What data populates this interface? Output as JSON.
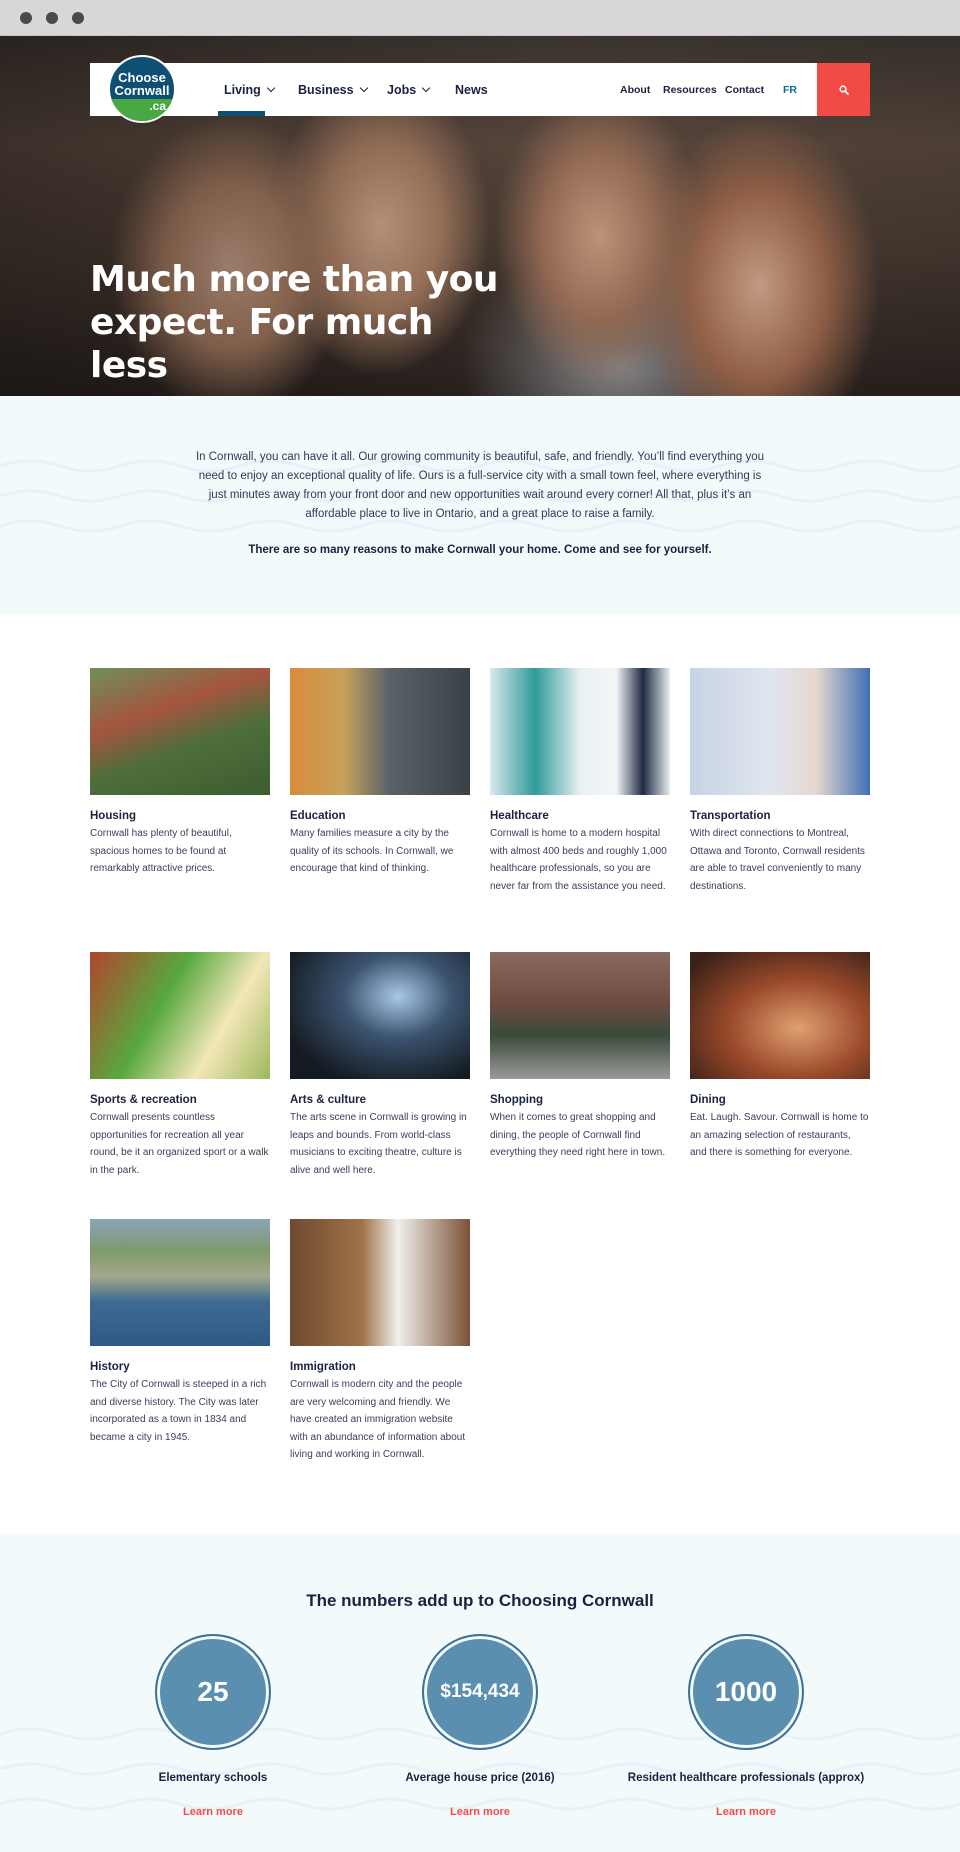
{
  "header": {
    "logo_text": "Choose Cornwall",
    "logo_suffix": ".ca",
    "nav": [
      {
        "label": "Living"
      },
      {
        "label": "Business"
      },
      {
        "label": "Jobs"
      },
      {
        "label": "News"
      }
    ],
    "secondary": [
      {
        "label": "About"
      },
      {
        "label": "Resources"
      },
      {
        "label": "Contact"
      },
      {
        "label": "FR"
      }
    ],
    "search_icon": "search-icon",
    "accent": "#f24a45",
    "brand": "#0f4f73"
  },
  "hero": {
    "title": "Much more than you expect. For much less"
  },
  "intro": {
    "paragraph": "In Cornwall, you can have it all. Our growing community is beautiful, safe, and friendly. You’ll find everything you need to enjoy an exceptional quality of life. Ours is a full-service city with a small town feel, where everything is just minutes away from your front door and new opportunities wait around every corner! All that, plus it’s an affordable place to live in Ontario, and a great place to raise a family.",
    "strong": "There are so many reasons to make Cornwall your home. Come and see for yourself."
  },
  "cards": [
    {
      "title": "Housing",
      "text": "Cornwall has plenty of beautiful, spacious homes to be found at remarkably attractive prices."
    },
    {
      "title": "Education",
      "text": "Many families measure a city by the quality of its schools. In Cornwall, we encourage that kind of thinking."
    },
    {
      "title": "Healthcare",
      "text": "Cornwall is home to a modern hospital with almost 400 beds and roughly 1,000 healthcare professionals, so you are never far from the assistance you need."
    },
    {
      "title": "Transportation",
      "text": "With direct connections to Montreal, Ottawa and Toronto, Cornwall residents are able to travel conveniently to many destinations."
    },
    {
      "title": "Sports & recreation",
      "text": "Cornwall presents countless opportunities for recreation all year round, be it an organized sport or a walk in the park."
    },
    {
      "title": "Arts & culture",
      "text": "The arts scene in Cornwall is growing in leaps and bounds. From world-class musicians to exciting theatre, culture is alive and well here."
    },
    {
      "title": "Shopping",
      "text": "When it comes to great shopping and dining, the people of Cornwall find everything they need right here in town."
    },
    {
      "title": "Dining",
      "text": "Eat. Laugh. Savour. Cornwall is home to an amazing selection of restaurants, and there is something for everyone."
    },
    {
      "title": "History",
      "text": "The City of Cornwall is steeped in a rich and diverse history. The City was later incorporated as a town in 1834 and became a city in 1945."
    },
    {
      "title": "Immigration",
      "text": "Cornwall is modern city and the people are very welcoming and friendly. We have created an immigration website with an abundance of information about living and working in Cornwall."
    }
  ],
  "numbers": {
    "title": "The numbers add up to Choosing Cornwall",
    "stats": [
      {
        "value": "25",
        "label": "Elementary schools",
        "link": "Learn more"
      },
      {
        "value": "$154,434",
        "label": "Average house price (2016)",
        "link": "Learn more"
      },
      {
        "value": "1000",
        "label": "Resident healthcare professionals (approx)",
        "link": "Learn more"
      }
    ]
  }
}
